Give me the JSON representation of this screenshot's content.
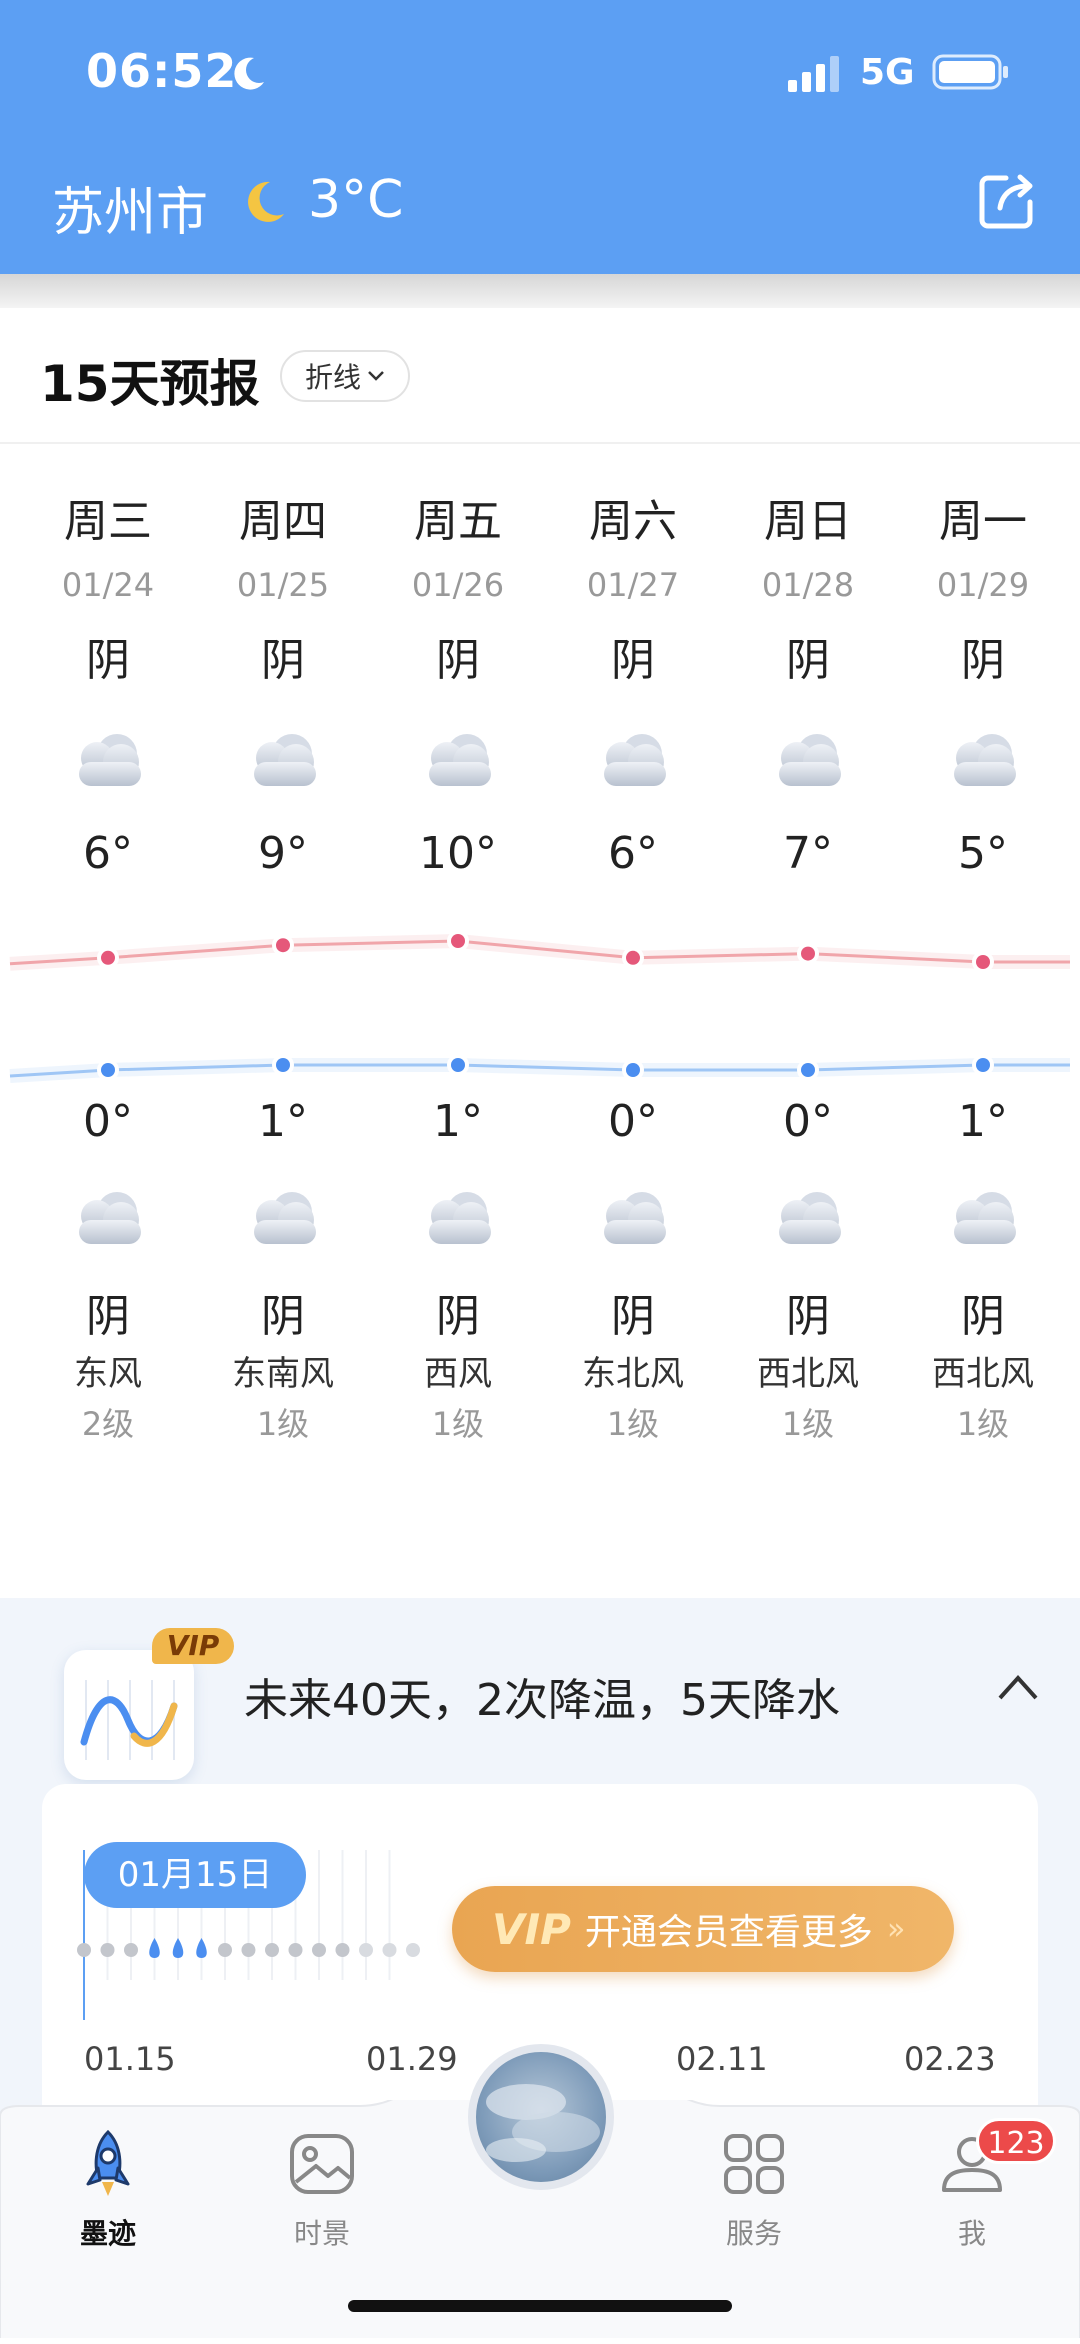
{
  "status_bar": {
    "time": "06:52",
    "network": "5G"
  },
  "header": {
    "city": "苏州市",
    "current_temp": "3°C",
    "weather_icon": "moon-icon",
    "share_icon": "share-icon"
  },
  "forecast": {
    "title": "15天预报",
    "mode": "折线",
    "days": [
      {
        "weekday": "周三",
        "date": "01/24",
        "day_cond": "阴",
        "high": "6°",
        "low": "0°",
        "night_cond": "阴",
        "wind_dir": "东风",
        "wind_level": "2级"
      },
      {
        "weekday": "周四",
        "date": "01/25",
        "day_cond": "阴",
        "high": "9°",
        "low": "1°",
        "night_cond": "阴",
        "wind_dir": "东南风",
        "wind_level": "1级"
      },
      {
        "weekday": "周五",
        "date": "01/26",
        "day_cond": "阴",
        "high": "10°",
        "low": "1°",
        "night_cond": "阴",
        "wind_dir": "西风",
        "wind_level": "1级"
      },
      {
        "weekday": "周六",
        "date": "01/27",
        "day_cond": "阴",
        "high": "6°",
        "low": "0°",
        "night_cond": "阴",
        "wind_dir": "东北风",
        "wind_level": "1级"
      },
      {
        "weekday": "周日",
        "date": "01/28",
        "day_cond": "阴",
        "high": "7°",
        "low": "0°",
        "night_cond": "阴",
        "wind_dir": "西北风",
        "wind_level": "1级"
      },
      {
        "weekday": "周一",
        "date": "01/29",
        "day_cond": "阴",
        "high": "5°",
        "low": "1°",
        "night_cond": "阴",
        "wind_dir": "西北风",
        "wind_level": "1级"
      }
    ],
    "high_values": [
      6,
      9,
      10,
      6,
      7,
      5
    ],
    "low_values": [
      0,
      1,
      1,
      0,
      0,
      1
    ],
    "colors": {
      "high_line": "#f0a5aa",
      "high_dot": "#e5587a",
      "low_line": "#9fc6f5",
      "low_dot": "#4b8ef0"
    }
  },
  "vip": {
    "badge": "VIP",
    "summary": "未来40天，2次降温，5天降水",
    "date_pill": "01月15日",
    "open_vip_mark": "VIP",
    "open_vip_label": "开通会员查看更多",
    "axis_labels": [
      "01.15",
      "01.29",
      "02.11",
      "02.23"
    ]
  },
  "bottom_nav": {
    "items": [
      {
        "label": "墨迹",
        "icon": "rocket-icon",
        "active": true
      },
      {
        "label": "时景",
        "icon": "photo-icon",
        "active": false
      },
      {
        "label": "服务",
        "icon": "grid-icon",
        "active": false
      },
      {
        "label": "我",
        "icon": "user-icon",
        "active": false
      }
    ],
    "badge_count": "123"
  },
  "accent_color": "#5c9ff3"
}
